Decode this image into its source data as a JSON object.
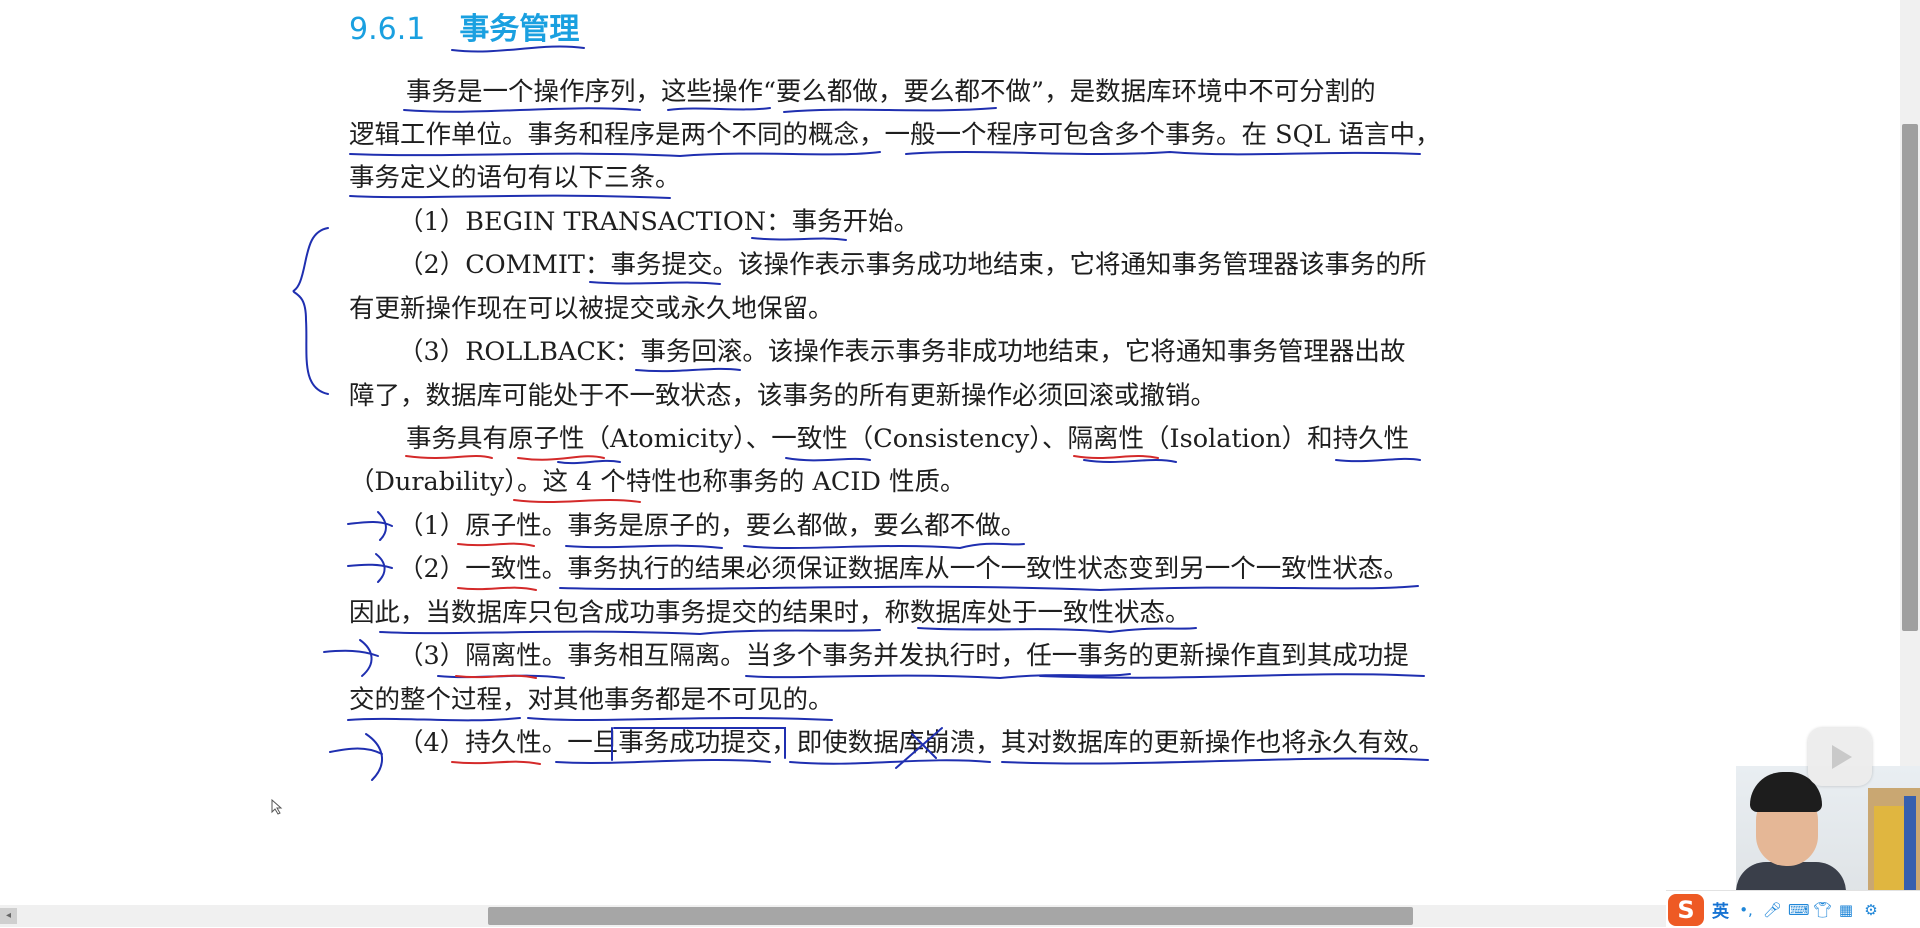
{
  "heading": {
    "number": "9.6.1",
    "title": "事务管理"
  },
  "paragraphs": [
    "事务是一个操作序列，这些操作“要么都做，要么都不做”，是数据库环境中不可分割的",
    "逻辑工作单位。事务和程序是两个不同的概念，一般一个程序可包含多个事务。在 SQL 语言中，",
    "事务定义的语句有以下三条。",
    "（1）BEGIN TRANSACTION：事务开始。",
    "（2）COMMIT：事务提交。该操作表示事务成功地结束，它将通知事务管理器该事务的所",
    "有更新操作现在可以被提交或永久地保留。",
    "（3）ROLLBACK：事务回滚。该操作表示事务非成功地结束，它将通知事务管理器出故",
    "障了，数据库可能处于不一致状态，该事务的所有更新操作必须回滚或撤销。",
    "事务具有原子性（Atomicity）、一致性（Consistency）、隔离性（Isolation）和持久性",
    "（Durability）。这 4 个特性也称事务的 ACID 性质。",
    "（1）原子性。事务是原子的，要么都做，要么都不做。",
    "（2）一致性。事务执行的结果必须保证数据库从一个一致性状态变到另一个一致性状态。",
    "因此，当数据库只包含成功事务提交的结果时，称数据库处于一致性状态。",
    "（3）隔离性。事务相互隔离。当多个事务并发执行时，任一事务的更新操作直到其成功提",
    "交的整个过程，对其他事务都是不可见的。",
    "（4）持久性。一旦事务成功提交，即使数据库崩溃，其对数据库的更新操作也将永久有效。"
  ],
  "ime": {
    "logo": "S",
    "lang": "英",
    "icons": [
      "punctuation-icon",
      "microphone-icon",
      "keyboard-icon",
      "skin-icon",
      "grid-icon",
      "settings-icon"
    ]
  },
  "colors": {
    "heading": "#1aa0e0",
    "ink_blue": "#1f2fb0",
    "ink_red": "#d42a2a",
    "ime_brand": "#ee5a24"
  }
}
